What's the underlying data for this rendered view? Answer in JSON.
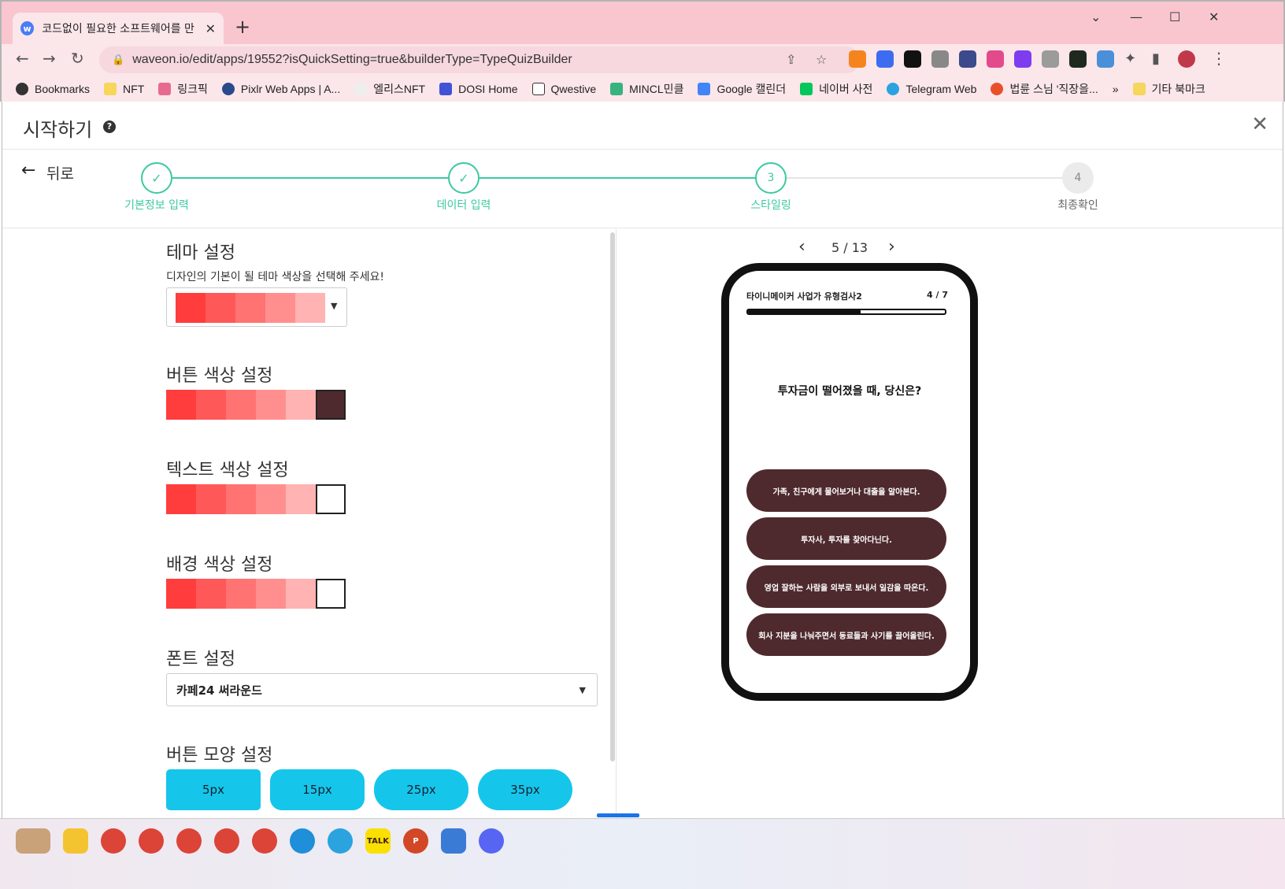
{
  "browser": {
    "tab_title": "코드없이 필요한 소프트웨어를 만",
    "favicon_letter": "w",
    "url": "waveon.io/edit/apps/19552?isQuickSetting=true&builderType=TypeQuizBuilder",
    "bookmarks": [
      "Bookmarks",
      "NFT",
      "링크픽",
      "Pixlr Web Apps | A...",
      "엘리스NFT",
      "DOSI Home",
      "Qwestive",
      "MINCL민클",
      "Google 캘린더",
      "네이버 사전",
      "Telegram Web",
      "법륜 스님 '직장을...",
      "»",
      "기타 북마크"
    ]
  },
  "modal": {
    "title": "시작하기",
    "help": "?",
    "close": "✕"
  },
  "stepper": {
    "back_label": "뒤로",
    "steps": [
      {
        "label": "기본정보 입력",
        "mark": "✓",
        "state": "done"
      },
      {
        "label": "데이터 입력",
        "mark": "✓",
        "state": "done"
      },
      {
        "label": "스타일링",
        "mark": "3",
        "state": "current"
      },
      {
        "label": "최종확인",
        "mark": "4",
        "state": "todo"
      }
    ],
    "accent": "#3cc9a0"
  },
  "settings": {
    "theme": {
      "title": "테마 설정",
      "desc": "디자인의 기본이 될 테마 색상을 선택해 주세요!"
    },
    "button_color": {
      "title": "버튼 색상 설정",
      "selected": "#4e2a2e"
    },
    "text_color": {
      "title": "텍스트 색상 설정",
      "selected": "#ffffff"
    },
    "background_color": {
      "title": "배경 색상 설정",
      "selected": "#ffffff"
    },
    "font": {
      "title": "폰트 설정",
      "value": "카페24 써라운드"
    },
    "button_shape": {
      "title": "버튼 모양 설정",
      "options": [
        "5px",
        "15px",
        "25px",
        "35px"
      ]
    },
    "palette": [
      "#ff3d3d",
      "#ff5858",
      "#ff7373",
      "#ff8f8f",
      "#ffb3b3"
    ]
  },
  "preview": {
    "pager": {
      "prev": "‹",
      "current": "5 / 13",
      "next": "›"
    },
    "quiz_title": "타이니메이커 사업가 유형검사2",
    "quiz_count": "4 / 7",
    "progress": 0.57,
    "question": "투자금이 떨어졌을 때, 당신은?",
    "answers": [
      "가족, 친구에게 물어보거나 대출을 알아본다.",
      "투자사, 투자를 찾아다닌다.",
      "영업 잘하는 사람을 외부로 보내서 일감을 따온다.",
      "회사 지분을 나눠주면서 동료들과 사기를 끌어올린다."
    ]
  }
}
